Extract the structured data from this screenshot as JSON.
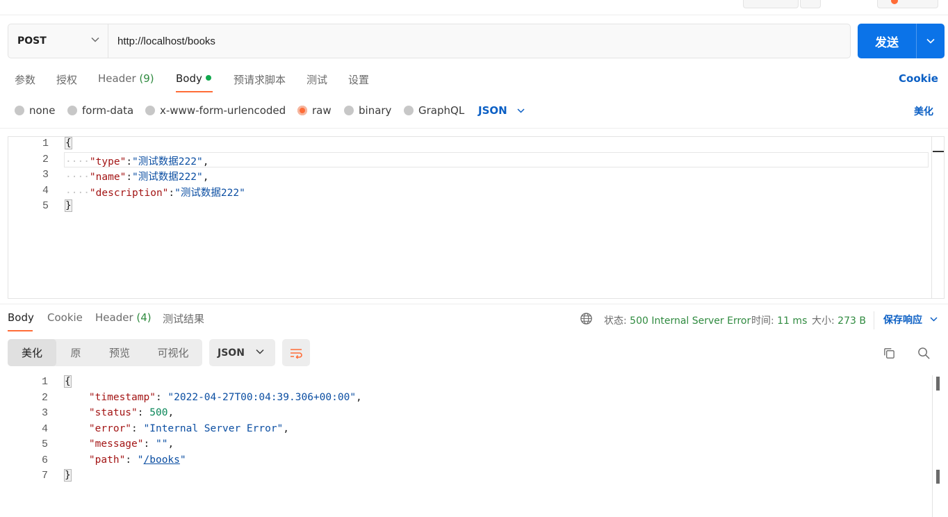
{
  "request": {
    "method": "POST",
    "url": "http://localhost/books",
    "send_label": "发送"
  },
  "request_tabs": {
    "params": "参数",
    "auth": "授权",
    "headers_label": "Header",
    "headers_count": "(9)",
    "body": "Body",
    "prerequest": "预请求脚本",
    "tests": "测试",
    "settings": "设置",
    "cookie_link": "Cookie"
  },
  "body_types": {
    "none": "none",
    "form_data": "form-data",
    "urlencoded": "x-www-form-urlencoded",
    "raw": "raw",
    "binary": "binary",
    "graphql": "GraphQL",
    "format": "JSON",
    "beautify": "美化",
    "selected": "raw"
  },
  "request_body": {
    "lines": [
      {
        "num": "1",
        "brace": "{"
      },
      {
        "num": "2",
        "key": "\"type\"",
        "sep": ":",
        "value": "\"测试数据222\"",
        "tail": ","
      },
      {
        "num": "3",
        "key": "\"name\"",
        "sep": ":",
        "value": "\"测试数据222\"",
        "tail": ","
      },
      {
        "num": "4",
        "key": "\"description\"",
        "sep": ":",
        "value": "\"测试数据222\"",
        "tail": ""
      },
      {
        "num": "5",
        "brace": "}"
      }
    ]
  },
  "response_tabs": {
    "body": "Body",
    "cookie": "Cookie",
    "headers_label": "Header",
    "headers_count": "(4)",
    "test_results": "测试结果"
  },
  "response_meta": {
    "status_label": "状态:",
    "status_value": "500 Internal Server Error",
    "time_label": "时间:",
    "time_value": "11 ms",
    "size_label": "大小:",
    "size_value": "273 B",
    "save_label": "保存响应"
  },
  "response_view": {
    "pretty": "美化",
    "raw": "原",
    "preview": "预览",
    "visualize": "可视化",
    "format": "JSON"
  },
  "response_body": {
    "lines": [
      {
        "num": "1",
        "brace": "{"
      },
      {
        "num": "2",
        "key": "\"timestamp\"",
        "sep": ": ",
        "value": "\"2022-04-27T00:04:39.306+00:00\"",
        "tail": ","
      },
      {
        "num": "3",
        "key": "\"status\"",
        "sep": ": ",
        "number": "500",
        "tail": ","
      },
      {
        "num": "4",
        "key": "\"error\"",
        "sep": ": ",
        "value": "\"Internal Server Error\"",
        "tail": ","
      },
      {
        "num": "5",
        "key": "\"message\"",
        "sep": ": ",
        "value": "\"\"",
        "tail": ","
      },
      {
        "num": "6",
        "key": "\"path\"",
        "sep": ": ",
        "link_open": "\"",
        "link": "/books",
        "link_close": "\"",
        "tail": ""
      },
      {
        "num": "7",
        "brace": "}"
      }
    ]
  },
  "colors": {
    "accent_orange": "#ff6c37",
    "send_blue": "#0b73e8",
    "link_blue": "#0b5fc4",
    "status_green": "#2f8a3f"
  }
}
